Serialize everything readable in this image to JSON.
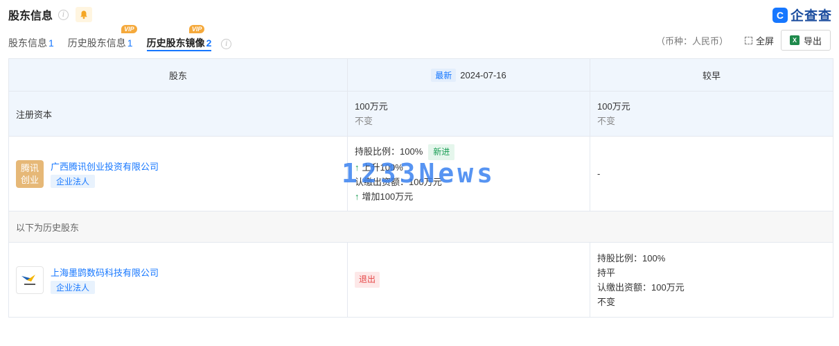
{
  "header": {
    "title": "股东信息",
    "brand": "企查查",
    "brand_mark": "C"
  },
  "tabs": [
    {
      "label": "股东信息",
      "count": "1",
      "vip": ""
    },
    {
      "label": "历史股东信息",
      "count": "1",
      "vip": "VIP"
    },
    {
      "label": "历史股东镜像",
      "count": "2",
      "vip": "VIP"
    }
  ],
  "toolbar": {
    "currency": "（币种：人民币）",
    "fullscreen_label": "全屏",
    "export_label": "导出",
    "excel_mark": "X"
  },
  "table": {
    "headers": {
      "shareholder": "股东",
      "latest_badge": "最新",
      "latest_date": "2024-07-16",
      "earlier": "较早"
    },
    "registered_capital": {
      "label": "注册资本",
      "latest_value": "100万元",
      "latest_change": "不变",
      "earlier_value": "100万元",
      "earlier_change": "不变"
    },
    "current_shareholders": [
      {
        "logo_text_1": "腾讯",
        "logo_text_2": "创业",
        "name": "广西腾讯创业投资有限公司",
        "tag": "企业法人",
        "latest": {
          "ratio": "持股比例：100%",
          "new_tag": "新进",
          "line2": "上升100%",
          "line3": "认缴出资额：100万元",
          "line4": "增加100万元"
        },
        "earlier": "-"
      }
    ],
    "history_divider": "以下为历史股东",
    "history_shareholders": [
      {
        "name": "上海墨鹍数码科技有限公司",
        "tag": "企业法人",
        "latest_tag": "退出",
        "earlier": {
          "ratio": "持股比例：100%",
          "ratio_change": "持平",
          "capital": "认缴出资额：100万元",
          "capital_change": "不变"
        }
      }
    ]
  },
  "watermark": "1233News",
  "colors": {
    "accent": "#1677ff",
    "header_bg": "#f0f6fd",
    "vip": "#f5a93b",
    "new_green": "#1a9e55",
    "exit_red": "#e54646"
  }
}
